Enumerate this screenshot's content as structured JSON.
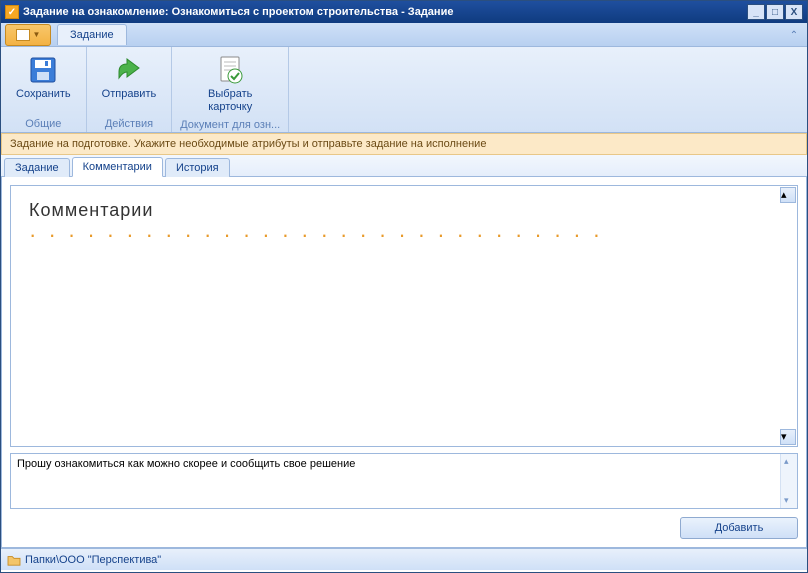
{
  "window": {
    "title": "Задание на ознакомление: Ознакомиться с проектом строительства - Задание"
  },
  "ribbon": {
    "tab_label": "Задание",
    "groups": {
      "common": {
        "caption": "Общие",
        "save": "Сохранить"
      },
      "actions": {
        "caption": "Действия",
        "send": "Отправить"
      },
      "doc": {
        "caption": "Документ для озн...",
        "select_card": "Выбрать\nкарточку"
      }
    }
  },
  "banner": "Задание на подготовке. Укажите необходимые атрибуты и отправьте задание на исполнение",
  "subtabs": {
    "task": "Задание",
    "comments": "Комментарии",
    "history": "История"
  },
  "comments": {
    "heading": "Комментарии",
    "input_value": "Прошу ознакомиться как можно скорее и сообщить свое решение",
    "add_btn": "Добавить"
  },
  "statusbar": {
    "path": "Папки\\ООО \"Перспектива\""
  }
}
